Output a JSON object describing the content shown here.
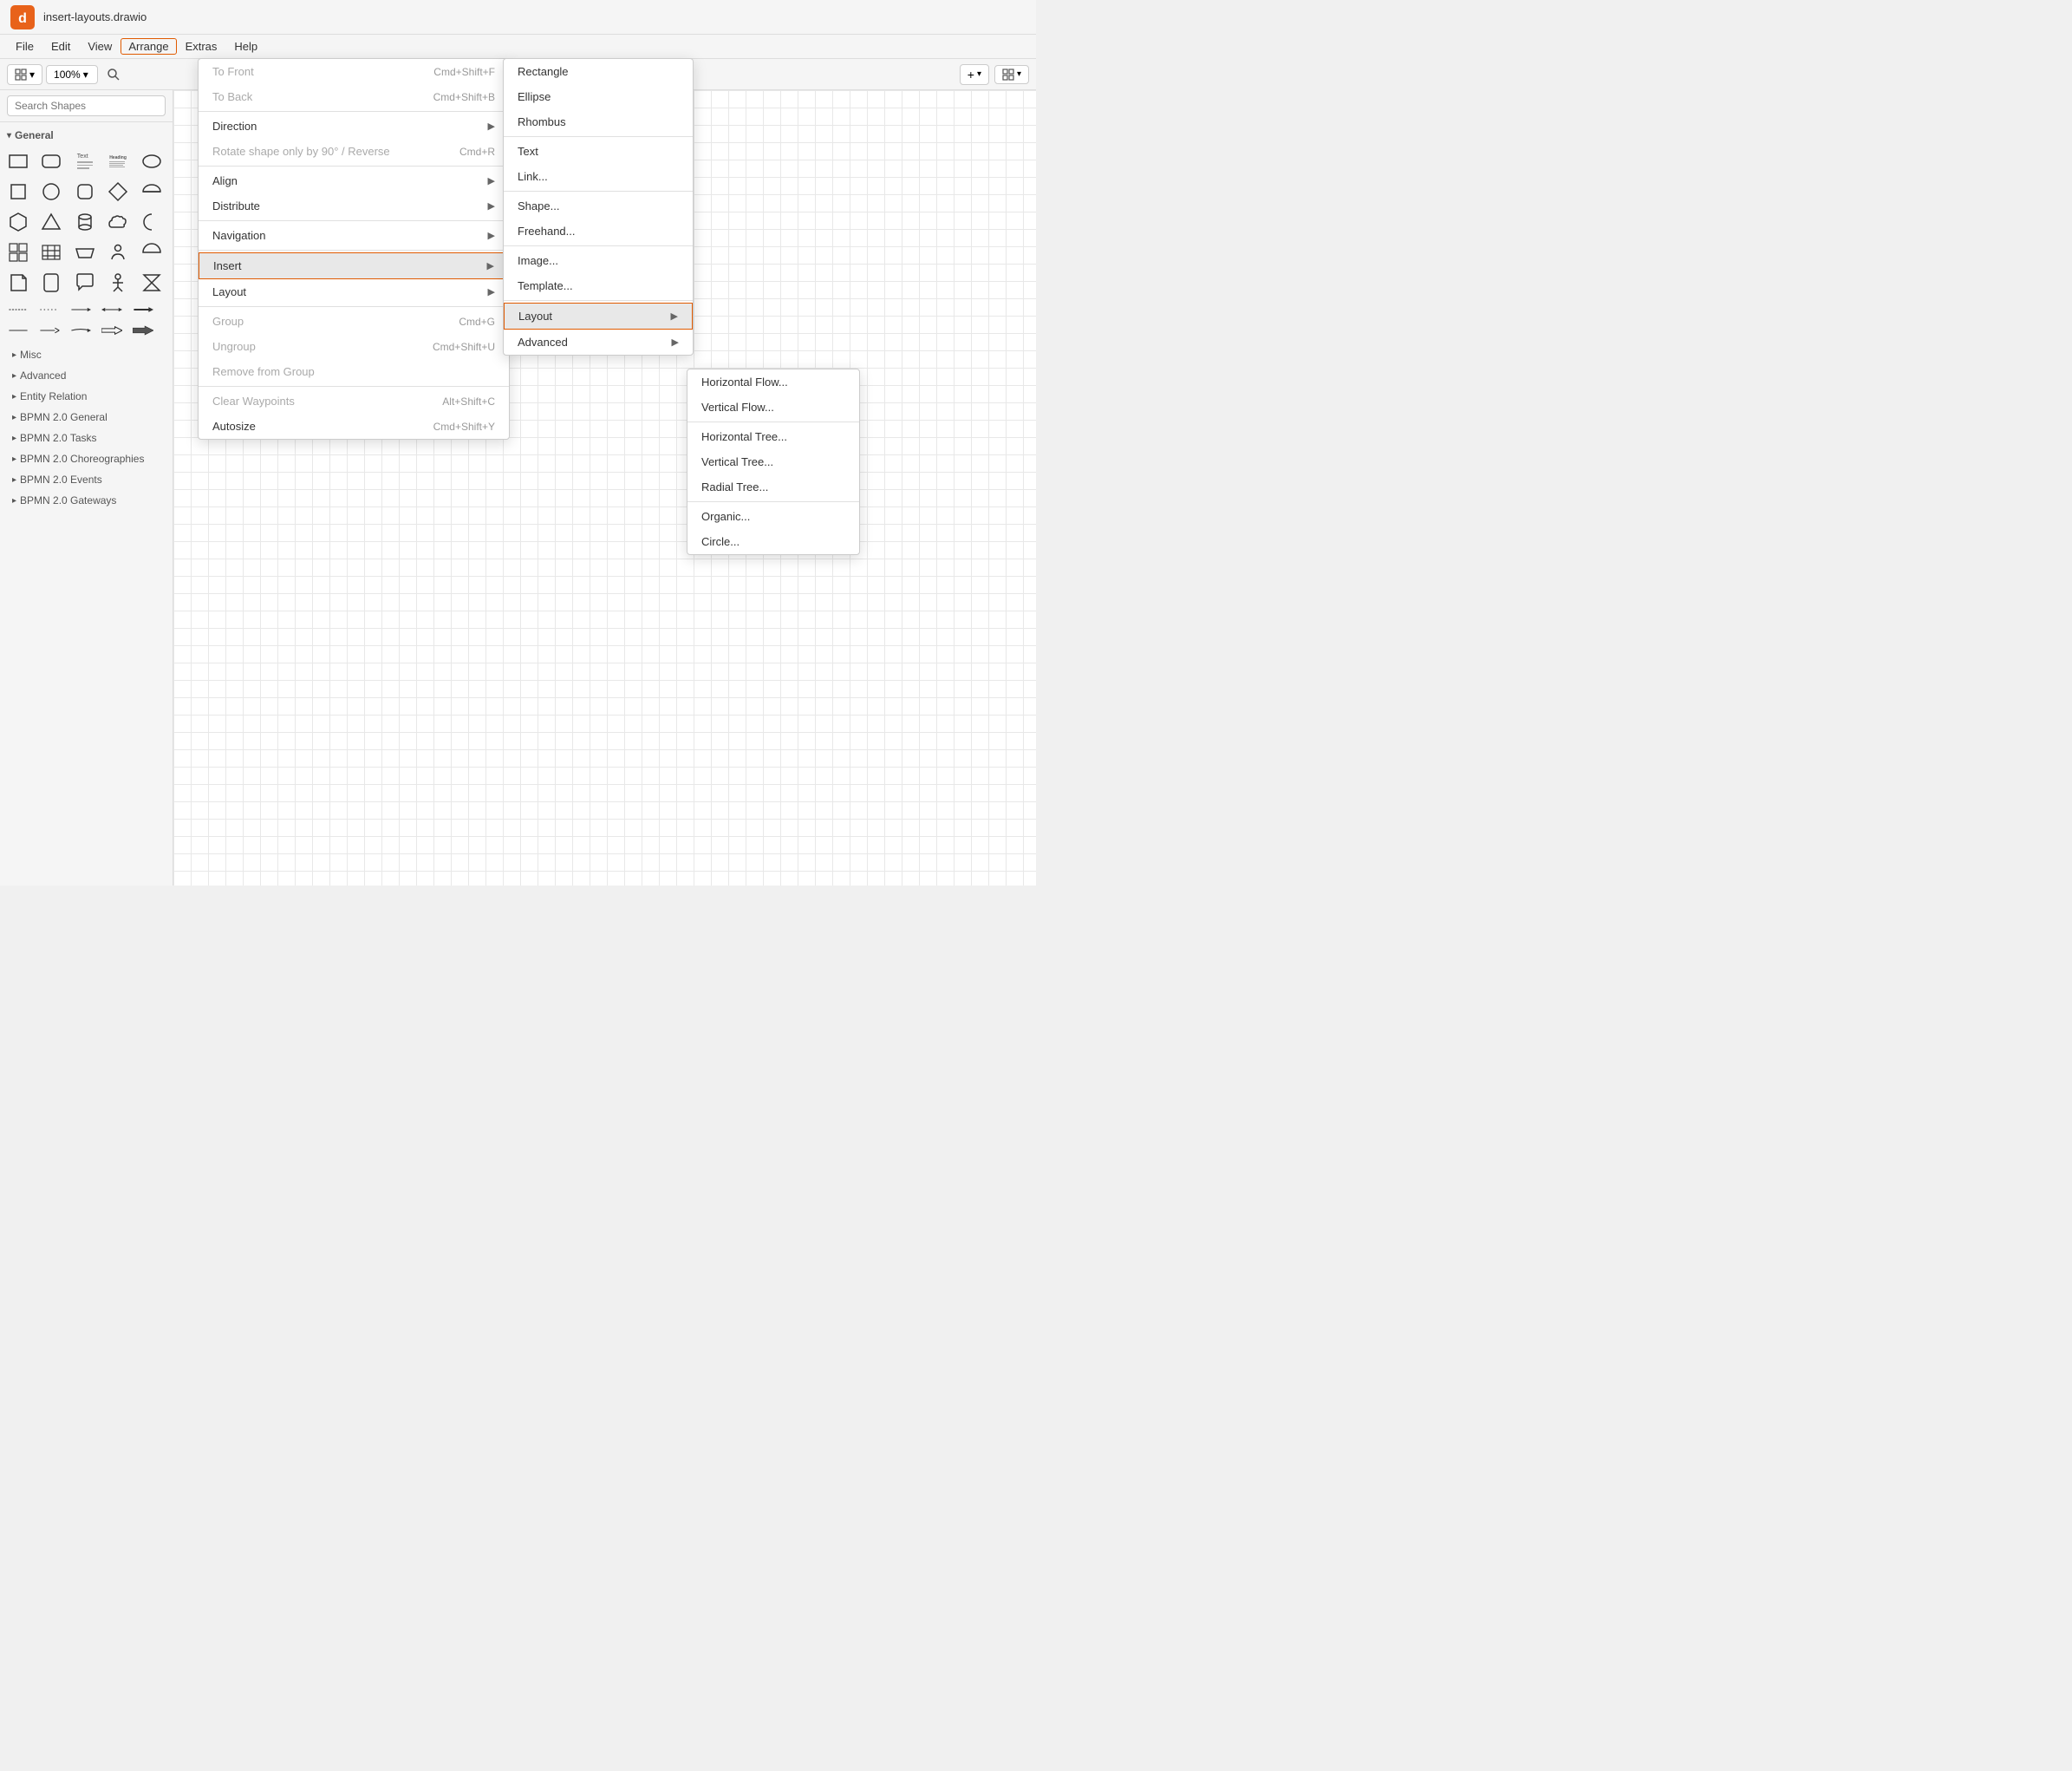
{
  "app": {
    "title": "insert-layouts.drawio",
    "logo_color": "#e8621a"
  },
  "menu_bar": {
    "items": [
      "File",
      "Edit",
      "View",
      "Arrange",
      "Extras",
      "Help"
    ]
  },
  "toolbar": {
    "zoom_level": "100%",
    "layout_btn": "⊞",
    "zoom_icon": "🔍",
    "add_btn": "+",
    "grid_btn": "⊞"
  },
  "sidebar": {
    "search_placeholder": "Search Shapes",
    "sections": [
      {
        "name": "General",
        "expanded": true
      },
      {
        "name": "Misc",
        "expanded": false
      },
      {
        "name": "Advanced",
        "expanded": false
      },
      {
        "name": "Entity Relation",
        "expanded": false
      },
      {
        "name": "BPMN 2.0 General",
        "expanded": false
      },
      {
        "name": "BPMN 2.0 Tasks",
        "expanded": false
      },
      {
        "name": "BPMN 2.0 Choreographies",
        "expanded": false
      },
      {
        "name": "BPMN 2.0 Events",
        "expanded": false
      },
      {
        "name": "BPMN 2.0 Gateways",
        "expanded": false
      }
    ]
  },
  "arrange_menu": {
    "items": [
      {
        "label": "To Front",
        "shortcut": "Cmd+Shift+F",
        "disabled": true
      },
      {
        "label": "To Back",
        "shortcut": "Cmd+Shift+B",
        "disabled": true
      },
      {
        "label": "separator"
      },
      {
        "label": "Direction",
        "arrow": true,
        "disabled": false
      },
      {
        "label": "Rotate shape only by 90° / Reverse",
        "shortcut": "Cmd+R",
        "disabled": true
      },
      {
        "label": "separator"
      },
      {
        "label": "Align",
        "arrow": true,
        "disabled": false
      },
      {
        "label": "Distribute",
        "arrow": true,
        "disabled": false
      },
      {
        "label": "separator"
      },
      {
        "label": "Navigation",
        "arrow": true,
        "disabled": false
      },
      {
        "label": "separator"
      },
      {
        "label": "Insert",
        "arrow": true,
        "disabled": false,
        "highlighted": true
      },
      {
        "label": "Layout",
        "arrow": true,
        "disabled": false
      },
      {
        "label": "separator"
      },
      {
        "label": "Group",
        "shortcut": "Cmd+G",
        "disabled": true
      },
      {
        "label": "Ungroup",
        "shortcut": "Cmd+Shift+U",
        "disabled": true
      },
      {
        "label": "Remove from Group",
        "disabled": true
      },
      {
        "label": "separator"
      },
      {
        "label": "Clear Waypoints",
        "shortcut": "Alt+Shift+C",
        "disabled": true
      },
      {
        "label": "Autosize",
        "shortcut": "Cmd+Shift+Y",
        "disabled": false
      }
    ]
  },
  "insert_submenu": {
    "items": [
      {
        "label": "Rectangle"
      },
      {
        "label": "Ellipse"
      },
      {
        "label": "Rhombus"
      },
      {
        "label": "separator"
      },
      {
        "label": "Text"
      },
      {
        "label": "Link..."
      },
      {
        "label": "separator"
      },
      {
        "label": "Shape..."
      },
      {
        "label": "Freehand..."
      },
      {
        "label": "separator"
      },
      {
        "label": "Image..."
      },
      {
        "label": "Template..."
      },
      {
        "label": "separator"
      },
      {
        "label": "Layout",
        "arrow": true,
        "highlighted": true
      },
      {
        "label": "Advanced",
        "arrow": true
      }
    ]
  },
  "layout_submenu": {
    "items": [
      {
        "label": "Horizontal Flow..."
      },
      {
        "label": "Vertical Flow..."
      },
      {
        "label": "separator"
      },
      {
        "label": "Horizontal Tree..."
      },
      {
        "label": "Vertical Tree..."
      },
      {
        "label": "Radial Tree..."
      },
      {
        "label": "separator"
      },
      {
        "label": "Organic..."
      },
      {
        "label": "Circle..."
      }
    ]
  }
}
